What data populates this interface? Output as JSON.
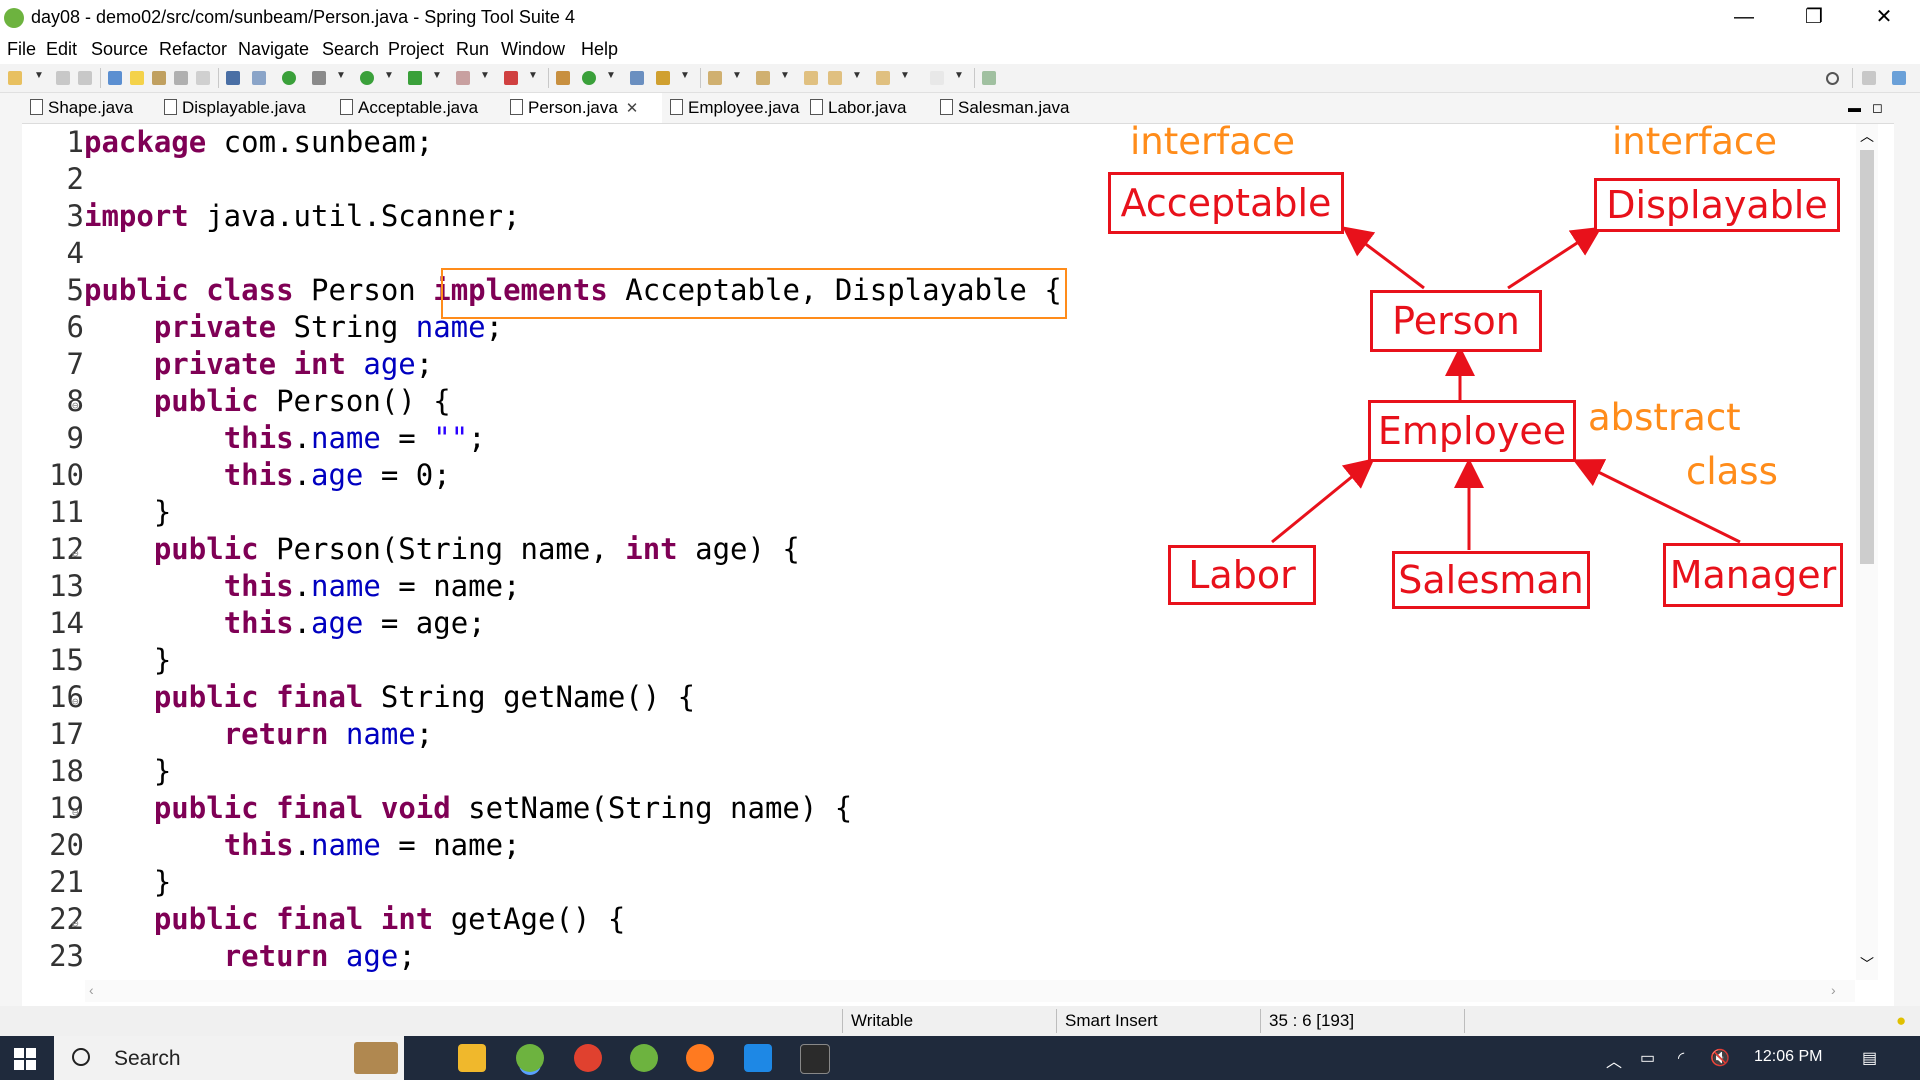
{
  "window": {
    "title": "day08 - demo02/src/com/sunbeam/Person.java - Spring Tool Suite 4",
    "minimize": "—",
    "restore": "❐",
    "close": "✕"
  },
  "menu": [
    "File",
    "Edit",
    "Source",
    "Refactor",
    "Navigate",
    "Search",
    "Project",
    "Run",
    "Window",
    "Help"
  ],
  "tabs": [
    {
      "label": "Shape.java"
    },
    {
      "label": "Displayable.java"
    },
    {
      "label": "Acceptable.java"
    },
    {
      "label": "Person.java",
      "active": true
    },
    {
      "label": "Employee.java"
    },
    {
      "label": "Labor.java"
    },
    {
      "label": "Salesman.java"
    }
  ],
  "editor": {
    "lines": [
      {
        "n": "1",
        "text": "package com.sunbeam;"
      },
      {
        "n": "2",
        "text": ""
      },
      {
        "n": "3",
        "text": "import java.util.Scanner;"
      },
      {
        "n": "4",
        "text": ""
      },
      {
        "n": "5",
        "text": "public class Person implements Acceptable, Displayable {"
      },
      {
        "n": "6",
        "text": "    private String name;"
      },
      {
        "n": "7",
        "text": "    private int age;"
      },
      {
        "n": "8",
        "text": "    public Person() {"
      },
      {
        "n": "9",
        "text": "        this.name = \"\";"
      },
      {
        "n": "10",
        "text": "        this.age = 0;"
      },
      {
        "n": "11",
        "text": "    }"
      },
      {
        "n": "12",
        "text": "    public Person(String name, int age) {"
      },
      {
        "n": "13",
        "text": "        this.name = name;"
      },
      {
        "n": "14",
        "text": "        this.age = age;"
      },
      {
        "n": "15",
        "text": "    }"
      },
      {
        "n": "16",
        "text": "    public final String getName() {"
      },
      {
        "n": "17",
        "text": "        return name;"
      },
      {
        "n": "18",
        "text": "    }"
      },
      {
        "n": "19",
        "text": "    public final void setName(String name) {"
      },
      {
        "n": "20",
        "text": "        this.name = name;"
      },
      {
        "n": "21",
        "text": "    }"
      },
      {
        "n": "22",
        "text": "    public final int getAge() {"
      },
      {
        "n": "23",
        "text": "        return age;"
      }
    ]
  },
  "diagram": {
    "interface_label_1": "interface",
    "interface_label_2": "interface",
    "abstract_label": "abstract",
    "class_label": "class",
    "acceptable": "Acceptable",
    "displayable": "Displayable",
    "person": "Person",
    "employee": "Employee",
    "labor": "Labor",
    "salesman": "Salesman",
    "manager": "Manager",
    "colors": {
      "box": "#e8111b",
      "annotation": "#ff8c1a"
    }
  },
  "status": {
    "mode": "Writable",
    "insert": "Smart Insert",
    "position": "35 : 6 [193]"
  },
  "taskbar": {
    "search_label": "Search",
    "time": "12:06 PM"
  }
}
